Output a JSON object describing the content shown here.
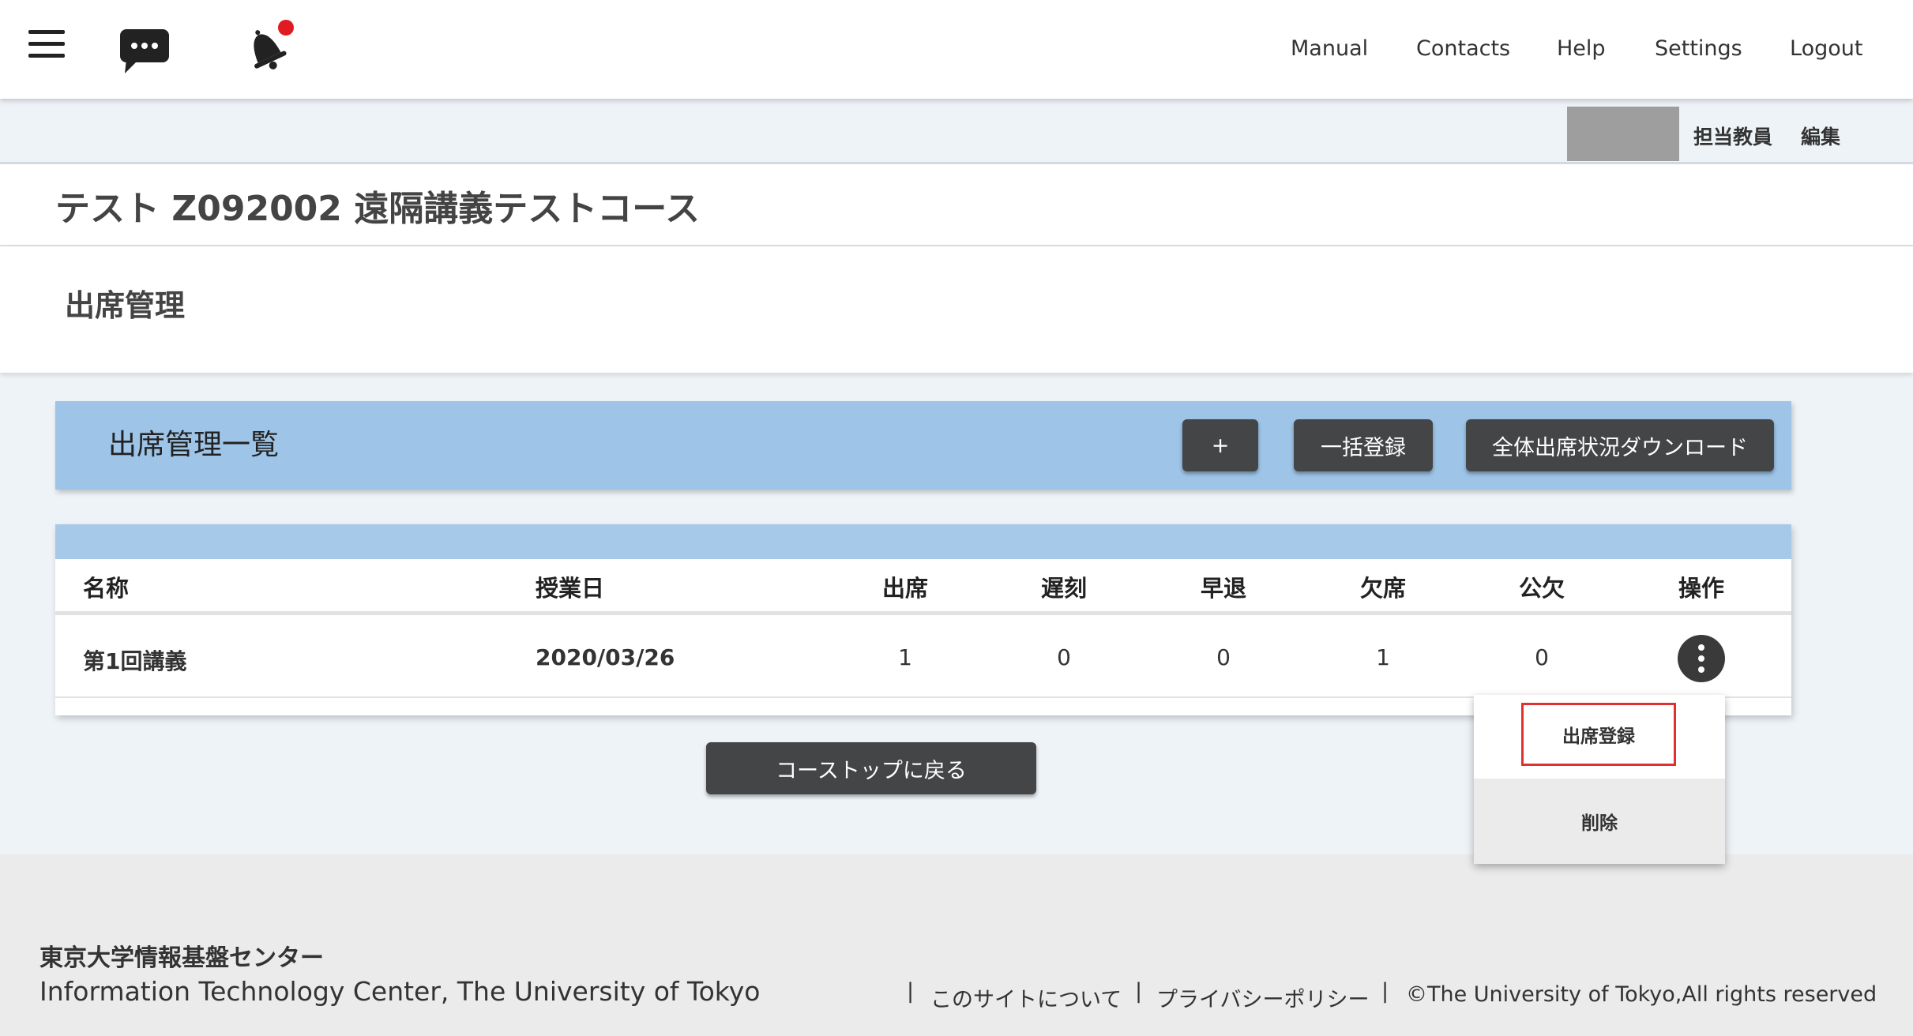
{
  "header": {
    "nav": [
      "Manual",
      "Contacts",
      "Help",
      "Settings",
      "Logout"
    ],
    "teacher_label": "担当教員",
    "edit_label": "編集"
  },
  "course": {
    "title": "テスト Z092002 遠隔講義テストコース"
  },
  "page": {
    "title": "出席管理"
  },
  "panel": {
    "title": "出席管理一覧",
    "add_button": "+",
    "bulk_button": "一括登録",
    "download_button": "全体出席状況ダウンロード"
  },
  "table": {
    "columns": [
      "名称",
      "授業日",
      "出席",
      "遅刻",
      "早退",
      "欠席",
      "公欠",
      "操作"
    ],
    "rows": [
      {
        "name": "第1回講義",
        "date": "2020/03/26",
        "present": "1",
        "late": "0",
        "early": "0",
        "absent": "1",
        "excused": "0"
      }
    ]
  },
  "menu": {
    "register": "出席登録",
    "delete": "削除"
  },
  "back_button": "コーストップに戻る",
  "footer": {
    "org_jp": "東京大学情報基盤センター",
    "org_en": "Information Technology Center, The University of Tokyo",
    "about": "このサイトについて",
    "privacy": "プライバシーポリシー",
    "copyright": "©The University of Tokyo,All rights reserved",
    "separator": "|"
  },
  "colors": {
    "panel": "#9ec4e8",
    "button": "#444546",
    "highlight": "#e03030"
  }
}
